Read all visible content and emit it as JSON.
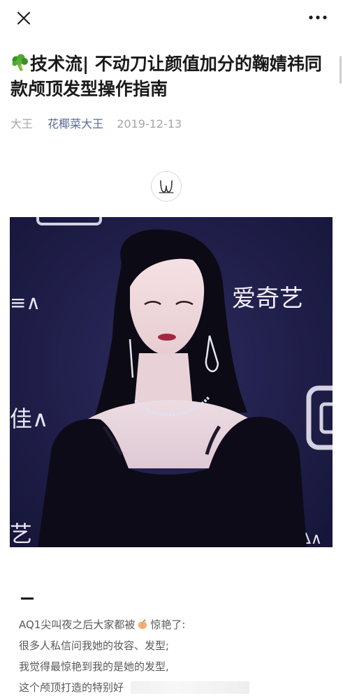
{
  "toolbar": {
    "close_icon": "close-icon",
    "more_icon": "more-dots-icon"
  },
  "article": {
    "title_emoji": "broccoli-emoji",
    "title": "技术流| 不动刀让颜值加分的鞠婧祎同款颅顶发型操作指南",
    "author": "大王",
    "account": "花椰菜大王",
    "date": "2019-12-13",
    "logo_icon": "account-logo-badge",
    "hero_image": {
      "description_icon": "hero-photo",
      "backdrop_texts": [
        "爱奇艺",
        "≡∧",
        "佳∧",
        "艺",
        "∧∆∧"
      ]
    },
    "body": {
      "line1_before": "AQ1尖叫夜之后大家都被",
      "line1_emoji": "peach-emoji",
      "line1_after": "惊艳了:",
      "line2": "很多人私信问我她的妆容、发型;",
      "line3": "我觉得最惊艳到我的是她的发型,",
      "line4": "这个颅顶打造的特别好"
    }
  },
  "colors": {
    "link": "#576b95",
    "meta_gray": "#a6a6a6",
    "body_text": "#595959",
    "hero_bg": "#1e1d45"
  }
}
